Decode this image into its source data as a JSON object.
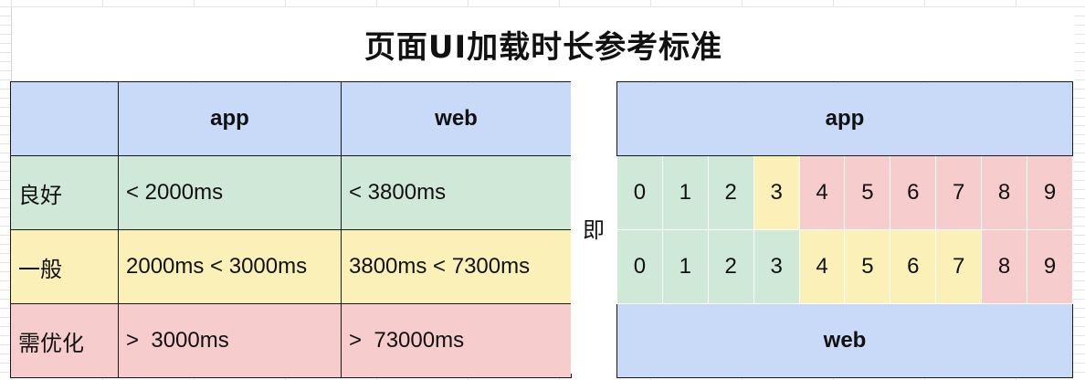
{
  "title": "页面UI加载时长参考标准",
  "left_table": {
    "header": [
      "",
      "app",
      "web"
    ],
    "rows": [
      {
        "level": "良好",
        "app": "< 2000ms",
        "web": "< 3800ms",
        "color": "#cfe8d8"
      },
      {
        "level": "一般",
        "app": "2000ms < 3000ms",
        "web": "3800ms < 7300ms",
        "color": "#fbf0b8"
      },
      {
        "level": "需优化",
        "app": ">  3000ms",
        "web": ">  73000ms",
        "color": "#f6cccc"
      }
    ]
  },
  "connector": "即",
  "right_table": {
    "top_label": "app",
    "bottom_label": "web",
    "app_scale": [
      {
        "digit": "0",
        "status": "good"
      },
      {
        "digit": "1",
        "status": "good"
      },
      {
        "digit": "2",
        "status": "good"
      },
      {
        "digit": "3",
        "status": "normal"
      },
      {
        "digit": "4",
        "status": "optimize"
      },
      {
        "digit": "5",
        "status": "optimize"
      },
      {
        "digit": "6",
        "status": "optimize"
      },
      {
        "digit": "7",
        "status": "optimize"
      },
      {
        "digit": "8",
        "status": "optimize"
      },
      {
        "digit": "9",
        "status": "optimize"
      }
    ],
    "web_scale": [
      {
        "digit": "0",
        "status": "good"
      },
      {
        "digit": "1",
        "status": "good"
      },
      {
        "digit": "2",
        "status": "good"
      },
      {
        "digit": "3",
        "status": "good"
      },
      {
        "digit": "4",
        "status": "normal"
      },
      {
        "digit": "5",
        "status": "normal"
      },
      {
        "digit": "6",
        "status": "normal"
      },
      {
        "digit": "7",
        "status": "normal"
      },
      {
        "digit": "8",
        "status": "optimize"
      },
      {
        "digit": "9",
        "status": "optimize"
      }
    ]
  },
  "colors": {
    "header": "#c9daf8",
    "good": "#cfe8d8",
    "normal": "#fbf0b8",
    "optimize": "#f6cccc"
  }
}
